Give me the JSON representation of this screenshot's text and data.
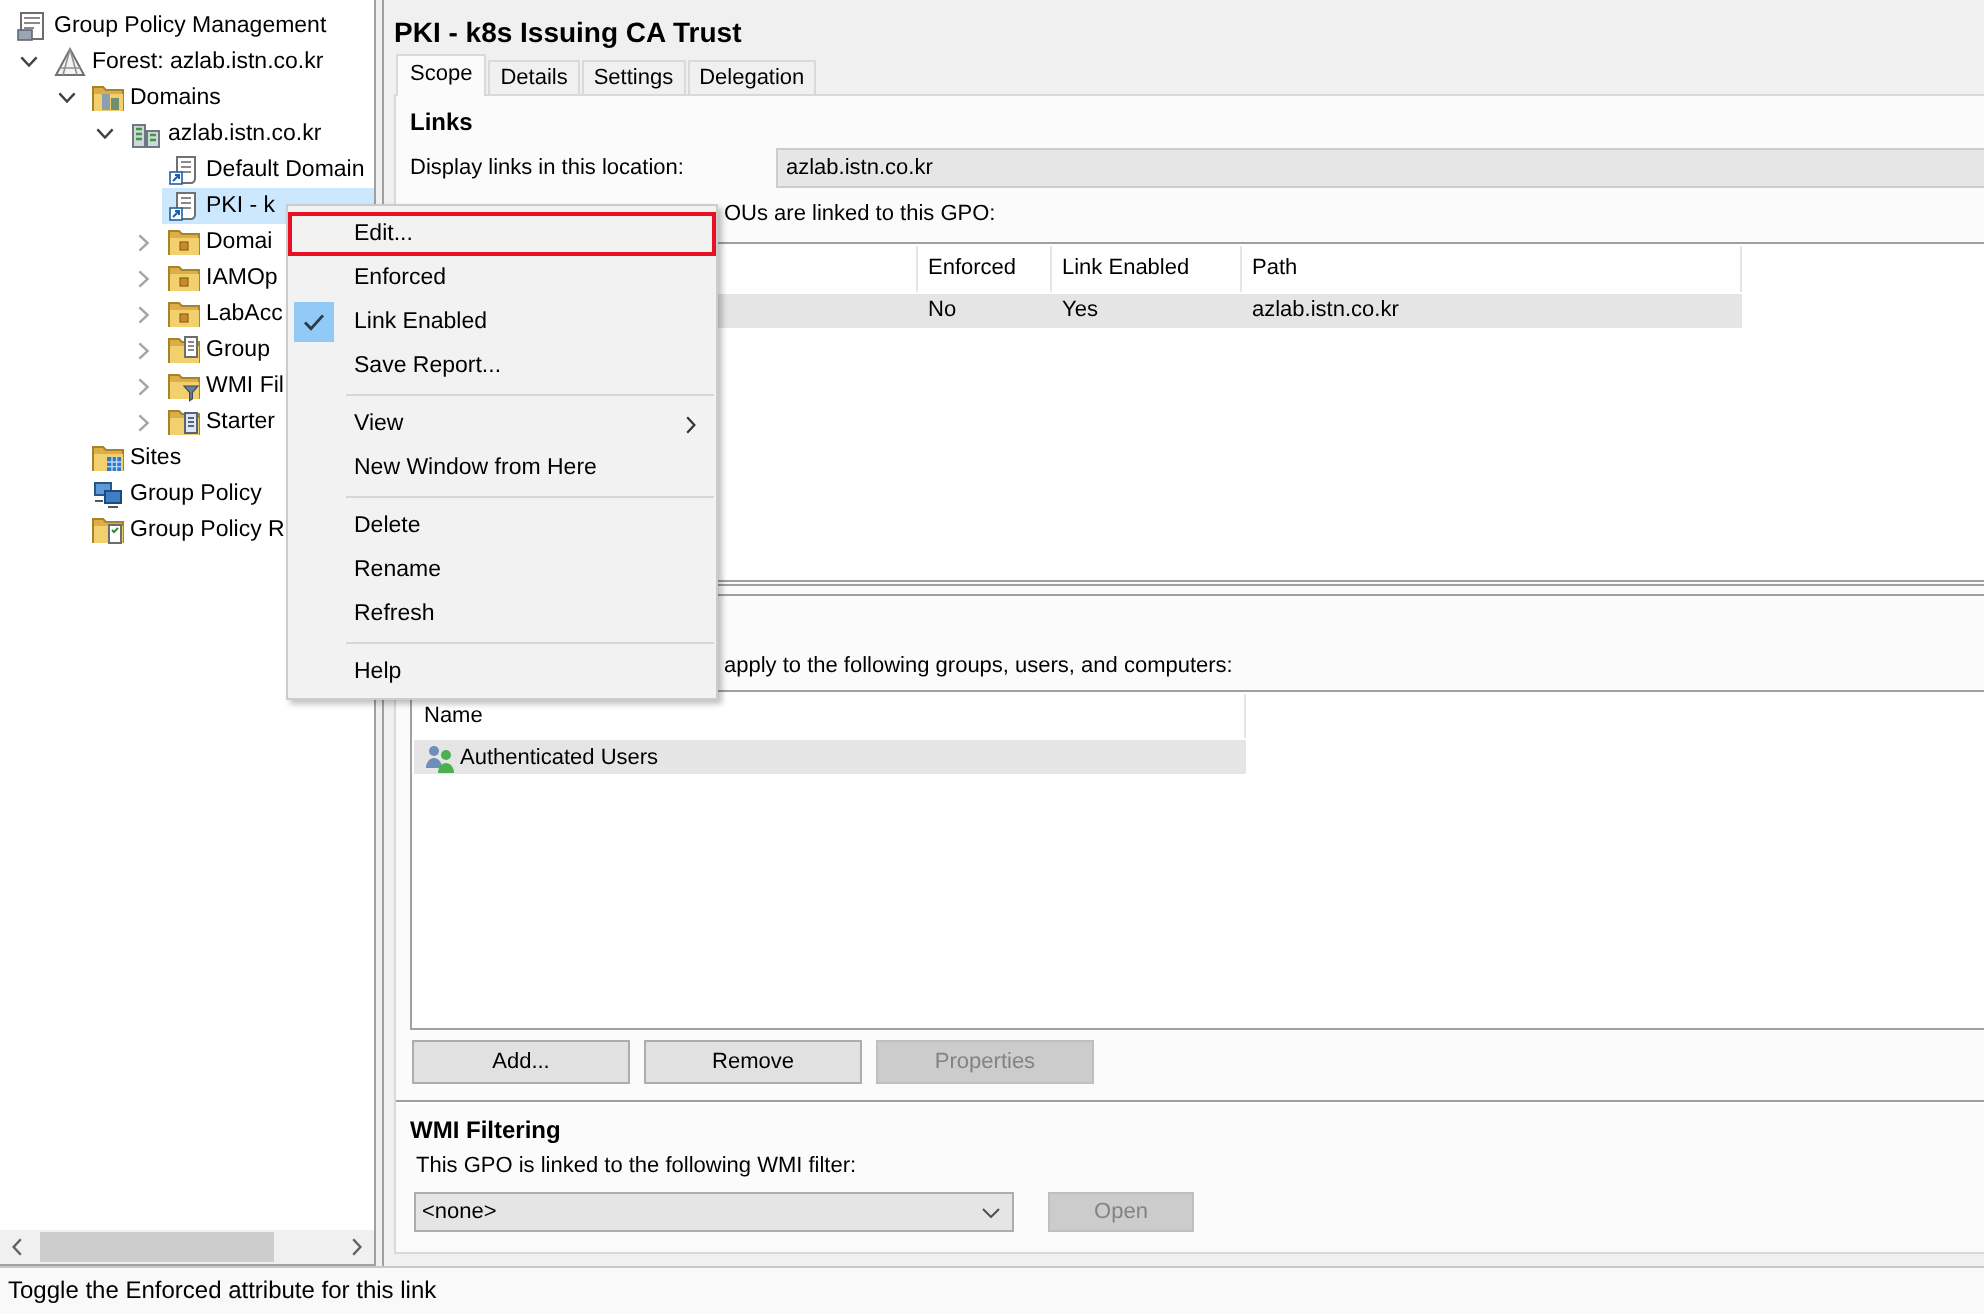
{
  "tree": [
    {
      "label": "Group Policy Management",
      "kind": "console",
      "selected": false,
      "children": [
        {
          "label": "Forest: azlab.istn.co.kr",
          "kind": "forest",
          "selected": false,
          "expanded": true,
          "children": [
            {
              "label": "Domains",
              "kind": "domains",
              "selected": false,
              "expanded": true,
              "children": [
                {
                  "label": "azlab.istn.co.kr",
                  "kind": "domain",
                  "selected": false,
                  "expanded": true,
                  "children": [
                    {
                      "label": "Default Domain",
                      "kind": "gpo-link",
                      "selected": false
                    },
                    {
                      "label": "PKI - k",
                      "kind": "gpo-link",
                      "selected": true
                    },
                    {
                      "label": "Domai",
                      "kind": "ou",
                      "selected": false,
                      "expanded": false
                    },
                    {
                      "label": "IAMOp",
                      "kind": "ou",
                      "selected": false,
                      "expanded": false
                    },
                    {
                      "label": "LabAcc",
                      "kind": "ou",
                      "selected": false,
                      "expanded": false
                    },
                    {
                      "label": "Group",
                      "kind": "gpo-folder",
                      "selected": false,
                      "expanded": false
                    },
                    {
                      "label": "WMI Fil",
                      "kind": "wmi-folder",
                      "selected": false,
                      "expanded": false
                    },
                    {
                      "label": "Starter",
                      "kind": "starter-folder",
                      "selected": false,
                      "expanded": false
                    }
                  ]
                }
              ]
            },
            {
              "label": "Sites",
              "kind": "sites",
              "selected": false
            },
            {
              "label": "Group Policy",
              "kind": "modeling",
              "selected": false
            },
            {
              "label": "Group Policy R",
              "kind": "results",
              "selected": false
            }
          ]
        }
      ]
    }
  ],
  "gpo_title": "PKI - k8s Issuing CA Trust",
  "tabs": [
    {
      "label": "Scope",
      "selected": true
    },
    {
      "label": "Details",
      "selected": false
    },
    {
      "label": "Settings",
      "selected": false
    },
    {
      "label": "Delegation",
      "selected": false
    }
  ],
  "links": {
    "heading": "Links",
    "location_label": "Display links in this location:",
    "location_value": "azlab.istn.co.kr",
    "note": "OUs are linked to this GPO:",
    "columns": [
      "Enforced",
      "Link Enabled",
      "Path"
    ],
    "rows": [
      {
        "cells": [
          "No",
          "Yes",
          "azlab.istn.co.kr"
        ],
        "selected": true
      }
    ]
  },
  "security": {
    "note": "apply to the following groups, users, and computers:",
    "columns": [
      "Name"
    ],
    "rows": [
      {
        "name": "Authenticated Users",
        "selected": true
      }
    ],
    "buttons": [
      {
        "label": "Add...",
        "disabled": false
      },
      {
        "label": "Remove",
        "disabled": false
      },
      {
        "label": "Properties",
        "disabled": true
      }
    ]
  },
  "wmi": {
    "heading": "WMI Filtering",
    "label": "This GPO is linked to the following WMI filter:",
    "value": "<none>",
    "button": {
      "label": "Open",
      "disabled": true
    }
  },
  "context_menu": {
    "items": [
      {
        "kind": "item",
        "label": "Edit...",
        "highlighted": true,
        "checked": false,
        "submenu": false
      },
      {
        "kind": "item",
        "label": "Enforced",
        "highlighted": false,
        "checked": false,
        "submenu": false
      },
      {
        "kind": "item",
        "label": "Link Enabled",
        "highlighted": false,
        "checked": true,
        "submenu": false
      },
      {
        "kind": "item",
        "label": "Save Report...",
        "highlighted": false,
        "checked": false,
        "submenu": false
      },
      {
        "kind": "separator"
      },
      {
        "kind": "item",
        "label": "View",
        "highlighted": false,
        "checked": false,
        "submenu": true
      },
      {
        "kind": "item",
        "label": "New Window from Here",
        "highlighted": false,
        "checked": false,
        "submenu": false
      },
      {
        "kind": "separator"
      },
      {
        "kind": "item",
        "label": "Delete",
        "highlighted": false,
        "checked": false,
        "submenu": false
      },
      {
        "kind": "item",
        "label": "Rename",
        "highlighted": false,
        "checked": false,
        "submenu": false
      },
      {
        "kind": "item",
        "label": "Refresh",
        "highlighted": false,
        "checked": false,
        "submenu": false
      },
      {
        "kind": "separator"
      },
      {
        "kind": "item",
        "label": "Help",
        "highlighted": false,
        "checked": false,
        "submenu": false
      }
    ]
  },
  "status_bar": "Toggle the Enforced attribute for this link"
}
